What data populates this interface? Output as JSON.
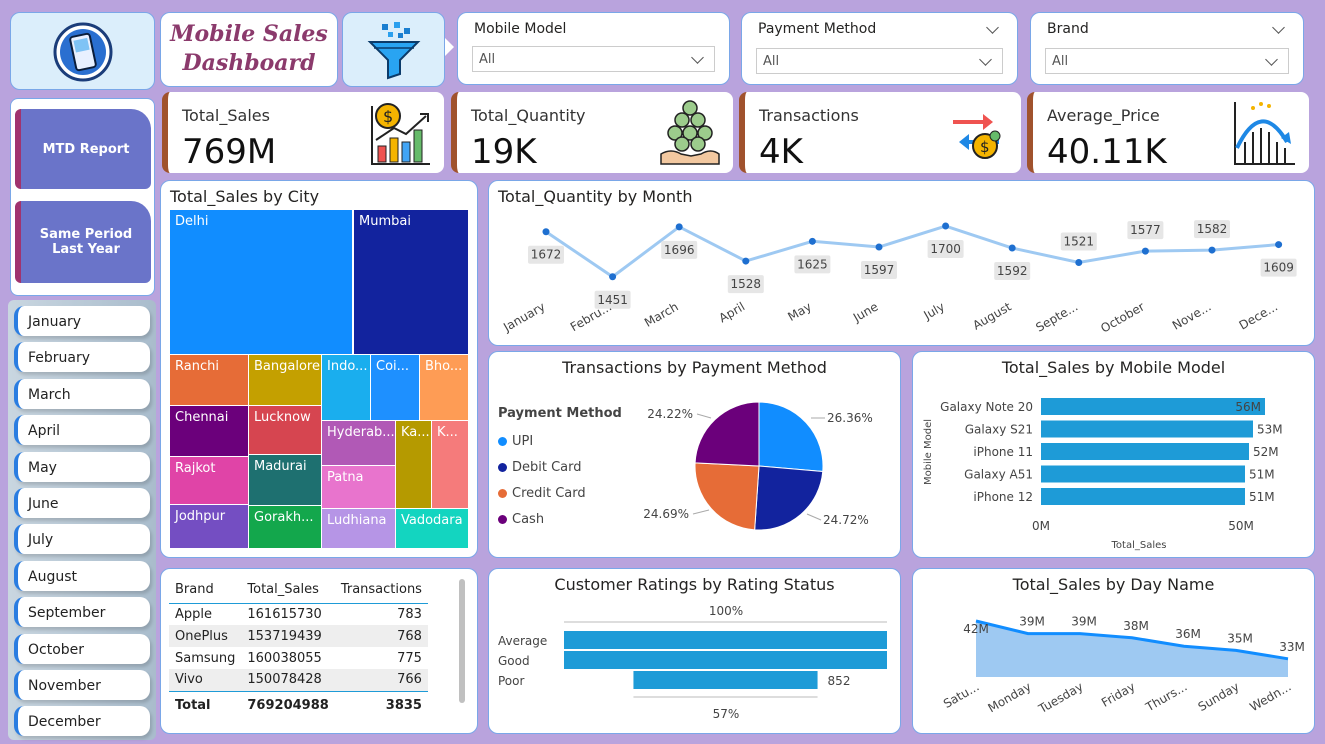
{
  "header": {
    "title_line1": "Mobile Sales",
    "title_line2": "Dashboard"
  },
  "icons": {
    "logo": "mobile-phone-icon",
    "filter": "funnel-filter-icon"
  },
  "filters": [
    {
      "label": "Mobile Model",
      "value": "All"
    },
    {
      "label": "Payment Method",
      "value": "All"
    },
    {
      "label": "Brand",
      "value": "All"
    }
  ],
  "nav": {
    "mtd": "MTD Report",
    "spl": "Same Period Last Year"
  },
  "kpis": [
    {
      "title": "Total_Sales",
      "value": "769M",
      "icon": "sales-growth-icon"
    },
    {
      "title": "Total_Quantity",
      "value": "19K",
      "icon": "coins-hand-icon"
    },
    {
      "title": "Transactions",
      "value": "4K",
      "icon": "money-exchange-icon"
    },
    {
      "title": "Average_Price",
      "value": "40.11K",
      "icon": "price-chart-icon"
    }
  ],
  "months": [
    "January",
    "February",
    "March",
    "April",
    "May",
    "June",
    "July",
    "August",
    "September",
    "October",
    "November",
    "December"
  ],
  "city": {
    "title": "Total_Sales by City",
    "cells": [
      "Delhi",
      "Mumbai",
      "Ranchi",
      "Bangalore",
      "Indo...",
      "Coi...",
      "Bho...",
      "Chennai",
      "Lucknow",
      "Hyderab...",
      "Ka...",
      "K...",
      "Rajkot",
      "Madurai",
      "Patna",
      "Jodhpur",
      "Gorakh...",
      "Ludhiana",
      "Vadodara"
    ]
  },
  "quantity_chart": {
    "title": "Total_Quantity by Month",
    "labels": [
      "January",
      "Febru...",
      "March",
      "April",
      "May",
      "June",
      "July",
      "August",
      "Septe...",
      "October",
      "Nove...",
      "Dece..."
    ]
  },
  "payment_chart": {
    "title": "Transactions by Payment Method",
    "legend_title": "Payment Method",
    "pct_labels": [
      "26.36%",
      "24.72%",
      "24.69%",
      "24.22%"
    ]
  },
  "model_chart": {
    "title": "Total_Sales by Mobile Model",
    "ylabel": "Mobile Model",
    "xlabel": "Total_Sales",
    "ticks": [
      "0M",
      "50M"
    ]
  },
  "brand_table": {
    "headers": [
      "Brand",
      "Total_Sales",
      "Transactions"
    ],
    "rows": [
      [
        "Apple",
        "161615730",
        "783"
      ],
      [
        "OnePlus",
        "153719439",
        "768"
      ],
      [
        "Samsung",
        "160038055",
        "775"
      ],
      [
        "Vivo",
        "150078428",
        "766"
      ]
    ],
    "total": [
      "Total",
      "769204988",
      "3835"
    ]
  },
  "ratings_chart": {
    "title": "Customer Ratings by Rating Status",
    "categories": [
      "Average",
      "Good",
      "Poor"
    ],
    "top_label": "100%",
    "bottom_label": "57%",
    "poor_value_label": "852"
  },
  "day_chart": {
    "title": "Total_Sales by Day Name",
    "labels": [
      "Satu...",
      "Monday",
      "Tuesday",
      "Friday",
      "Thurs...",
      "Sunday",
      "Wedn..."
    ]
  },
  "chart_data": [
    {
      "type": "line",
      "title": "Total_Quantity by Month",
      "x": [
        "January",
        "February",
        "March",
        "April",
        "May",
        "June",
        "July",
        "August",
        "September",
        "October",
        "November",
        "December"
      ],
      "series": [
        {
          "values": [
            1672,
            1451,
            1696,
            1528,
            1625,
            1597,
            1700,
            1592,
            1521,
            1577,
            1582,
            1609
          ]
        }
      ],
      "color": "#9ec9f2"
    },
    {
      "type": "pie",
      "title": "Transactions by Payment Method",
      "categories": [
        "UPI",
        "Debit Card",
        "Credit Card",
        "Cash"
      ],
      "values": [
        26.36,
        24.72,
        24.69,
        24.22
      ],
      "colors": [
        "#118dff",
        "#12239e",
        "#e66c37",
        "#6b007b"
      ]
    },
    {
      "type": "bar",
      "title": "Total_Sales by Mobile Model",
      "categories": [
        "Galaxy Note 20",
        "Galaxy S21",
        "iPhone 11",
        "Galaxy A51",
        "iPhone 12"
      ],
      "values": [
        56,
        53,
        52,
        51,
        51
      ],
      "value_labels": [
        "56M",
        "53M",
        "52M",
        "51M",
        "51M"
      ],
      "xlabel": "Total_Sales",
      "ylabel": "Mobile Model",
      "color": "#1e9bd7"
    },
    {
      "type": "bar",
      "title": "Customer Ratings by Rating Status",
      "categories": [
        "Average",
        "Good",
        "Poor"
      ],
      "values": [
        100,
        100,
        57
      ],
      "color": "#1e9bd7"
    },
    {
      "type": "area",
      "title": "Total_Sales by Day Name",
      "x": [
        "Saturday",
        "Monday",
        "Tuesday",
        "Friday",
        "Thursday",
        "Sunday",
        "Wednesday"
      ],
      "values": [
        42,
        39,
        39,
        38,
        36,
        35,
        33
      ],
      "value_labels": [
        "42M",
        "39M",
        "39M",
        "38M",
        "36M",
        "35M",
        "33M"
      ],
      "color": "#118dff"
    },
    {
      "type": "heatmap",
      "title": "Total_Sales by City",
      "categories": [
        "Delhi",
        "Mumbai",
        "Ranchi",
        "Bangalore",
        "Indo...",
        "Coi...",
        "Bho...",
        "Chennai",
        "Lucknow",
        "Hyderab...",
        "Ka...",
        "K...",
        "Rajkot",
        "Madurai",
        "Patna",
        "Jodhpur",
        "Gorakh...",
        "Ludhiana",
        "Vadodara"
      ]
    }
  ]
}
